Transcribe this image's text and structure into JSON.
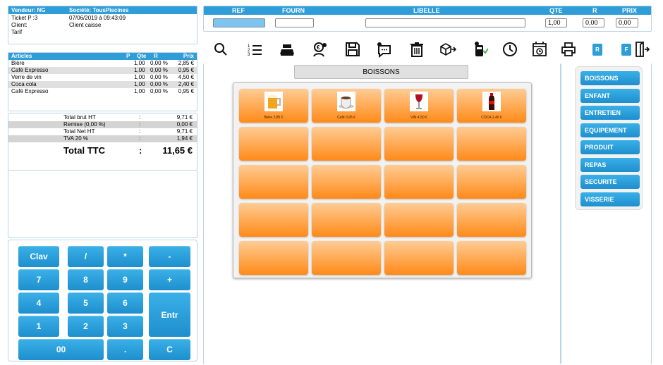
{
  "header": {
    "vendeur": "Vendeur: NG",
    "societe": "Société: TousPiscines",
    "ticket_label": "Ticket P :3",
    "ticket_date": "07/06/2019 à 09:43:09",
    "client_label": "Client:",
    "client_value": "Client caisse",
    "tarif_label": "Tarif"
  },
  "articles": {
    "headers": {
      "name": "Articles",
      "p": "P",
      "qte": "Qte",
      "r": "R",
      "prix": "Prix"
    },
    "rows": [
      {
        "name": "Bière",
        "qte": "1,00",
        "r": "0,00 %",
        "prix": "2,85 €"
      },
      {
        "name": "Café Expresso",
        "qte": "1,00",
        "r": "0,00 %",
        "prix": "0,95 €"
      },
      {
        "name": "Verre de vin",
        "qte": "1,00",
        "r": "0,00 %",
        "prix": "4,50 €"
      },
      {
        "name": "Coca cola",
        "qte": "1,00",
        "r": "0,00 %",
        "prix": "2,40 €"
      },
      {
        "name": "Café Expresso",
        "qte": "1,00",
        "r": "0,00 %",
        "prix": "0,95 €"
      }
    ]
  },
  "totals": {
    "rows": [
      {
        "label": "Total brut HT",
        "sep": ":",
        "value": "9,71  €"
      },
      {
        "label": "Remise (0,00 %)",
        "sep": ":",
        "value": "0,00  €"
      },
      {
        "label": "Total Net HT",
        "sep": ":",
        "value": "9,71  €"
      },
      {
        "label": "TVA 20 %",
        "sep": ":",
        "value": "1,94  €"
      }
    ],
    "ttc_label": "Total TTC",
    "ttc_sep": ":",
    "ttc_value": "11,65  €"
  },
  "keypad": {
    "keys": [
      "Clav",
      "/",
      "*",
      "-",
      "7",
      "8",
      "9",
      "+",
      "4",
      "5",
      "6",
      "Entr",
      "1",
      "2",
      "3",
      "00",
      ".",
      "C"
    ]
  },
  "fields": {
    "headers": {
      "ref": "REF",
      "fourn": "FOURN",
      "libelle": "LIBELLE",
      "qte": "QTE",
      "r": "R",
      "prix": "PRIX"
    },
    "values": {
      "ref": "",
      "fourn": "",
      "libelle": "",
      "qte": "1,00",
      "r": "0,00",
      "prix": "0,00"
    }
  },
  "toolbar": {
    "icons": [
      "search-icon",
      "list-icon",
      "cash-register-icon",
      "customer-icon",
      "save-icon",
      "chat-icon",
      "trash-icon",
      "box-out-icon",
      "payment-terminal-icon",
      "clock-icon",
      "calendar-clock-icon",
      "printer-icon",
      "exit-door-icon"
    ],
    "r_label": "R",
    "f_label": "F"
  },
  "category_banner": "BOISSONS",
  "products": [
    {
      "label": "Bière 2,85 €",
      "icon": "beer-icon"
    },
    {
      "label": "Café 0,95 €",
      "icon": "coffee-icon"
    },
    {
      "label": "VIN 4,50 €",
      "icon": "wine-icon"
    },
    {
      "label": "COCA 2,40 €",
      "icon": "cola-icon"
    }
  ],
  "categories": [
    "BOISSONS",
    "ENFANT",
    "ENTRETIEN",
    "EQUIPEMENT",
    "PRODUIT",
    "REPAS",
    "SECURITE",
    "VISSERIE"
  ],
  "colors": {
    "accent": "#2f9ed8",
    "product_gradient_top": "#ffcc94",
    "product_gradient_bottom": "#ff8a18"
  }
}
